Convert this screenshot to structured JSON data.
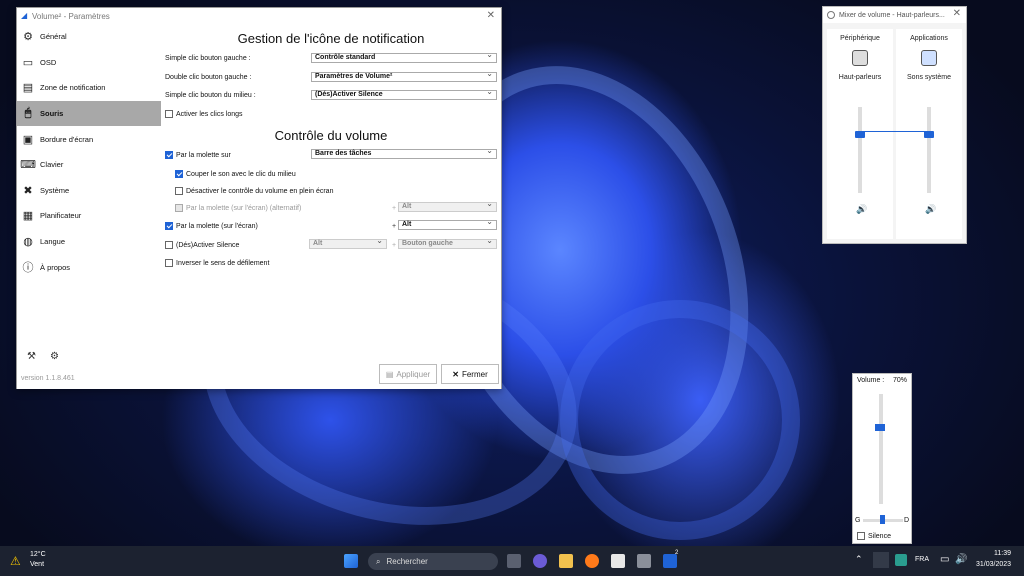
{
  "settings_window": {
    "title": "Volume² - Paramètres",
    "version": "version 1.1.8.461",
    "sidebar": [
      {
        "label": "Général",
        "icon": "gear-icon"
      },
      {
        "label": "OSD",
        "icon": "monitor-icon"
      },
      {
        "label": "Zone de notification",
        "icon": "notification-area-icon"
      },
      {
        "label": "Souris",
        "icon": "mouse-icon",
        "active": true
      },
      {
        "label": "Bordure d'écran",
        "icon": "screen-border-icon"
      },
      {
        "label": "Clavier",
        "icon": "keyboard-icon"
      },
      {
        "label": "Système",
        "icon": "tools-icon"
      },
      {
        "label": "Planificateur",
        "icon": "calendar-icon"
      },
      {
        "label": "Langue",
        "icon": "globe-icon"
      },
      {
        "label": "À propos",
        "icon": "info-icon"
      }
    ],
    "section1": {
      "title": "Gestion de l'icône de notification",
      "left_click_label": "Simple clic bouton gauche :",
      "left_click_value": "Contrôle standard",
      "double_left_label": "Double clic bouton gauche :",
      "double_left_value": "Paramètres de Volume²",
      "middle_click_label": "Simple clic bouton du milieu :",
      "middle_click_value": "(Dés)Activer Silence",
      "long_clicks_label": "Activer les clics longs"
    },
    "section2": {
      "title": "Contrôle du volume",
      "wheel_on_label": "Par la molette sur",
      "wheel_on_value": "Barre des tâches",
      "mute_middle_label": "Couper le son avec le clic du milieu",
      "disable_fullscreen_label": "Désactiver le contrôle du volume en plein écran",
      "wheel_screen_alt_label": "Par la molette (sur l'écran) (alternatif)",
      "wheel_screen_alt_value": "Alt",
      "wheel_screen_label": "Par la molette (sur l'écran)",
      "wheel_screen_value": "Alt",
      "toggle_silence_label": "(Dés)Activer Silence",
      "toggle_silence_mod": "Alt",
      "toggle_silence_btn": "Bouton gauche",
      "invert_label": "Inverser le sens de défilement",
      "plus": "+"
    },
    "apply_label": "Appliquer",
    "close_label": "Fermer"
  },
  "mixer": {
    "title": "Mixer de volume - Haut-parleurs...",
    "device_header": "Périphérique",
    "apps_header": "Applications",
    "device_name": "Haut-parleurs",
    "app_name": "Sons système"
  },
  "volume_popup": {
    "label": "Volume :",
    "percent": "70%",
    "left": "G",
    "right": "D",
    "silence_label": "Silence",
    "level": 0.7
  },
  "taskbar": {
    "weather_temp": "12°C",
    "weather_desc": "Vent",
    "search_placeholder": "Rechercher",
    "lang": "FRA",
    "time": "11:39",
    "date": "31/03/2023",
    "badge": "2"
  }
}
